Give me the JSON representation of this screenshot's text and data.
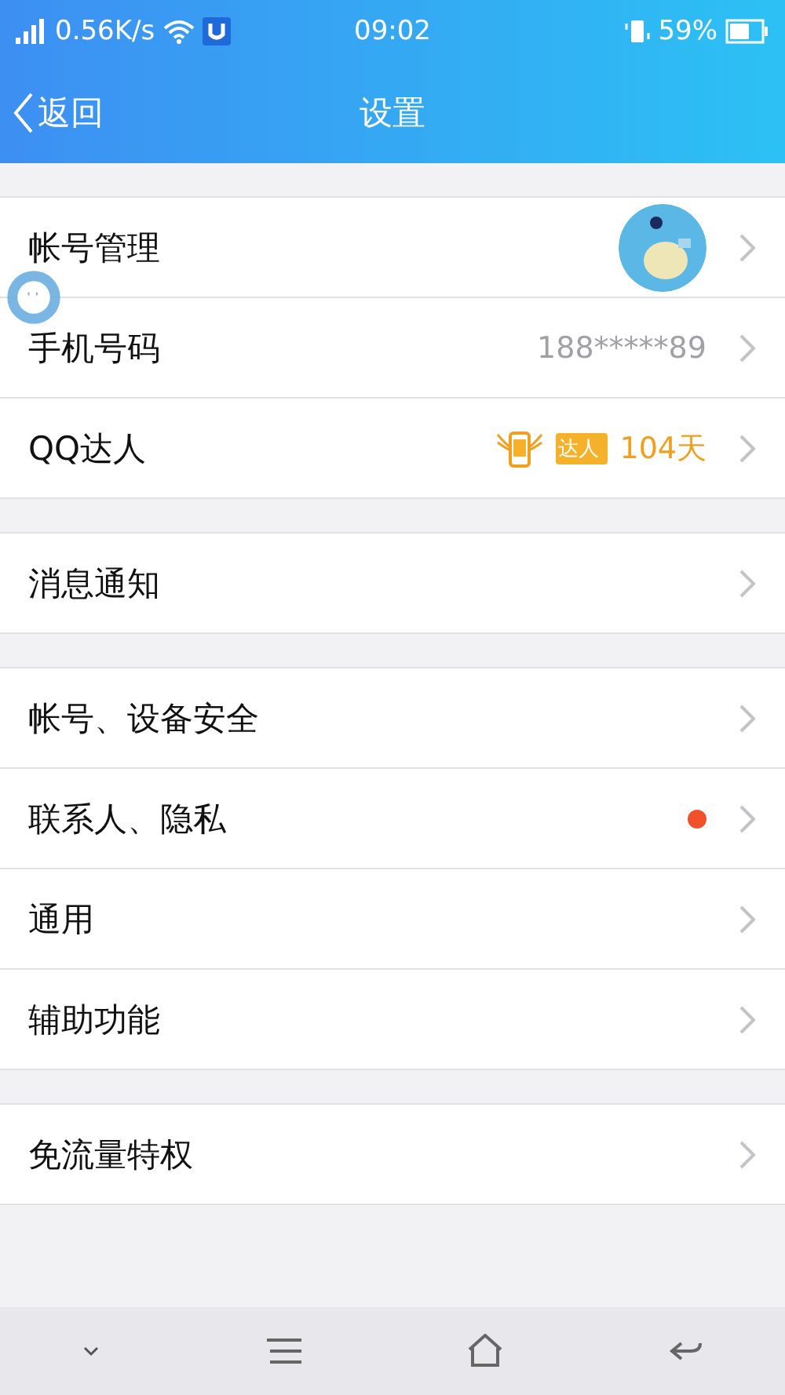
{
  "status_bar": {
    "speed": "0.56K/s",
    "time": "09:02",
    "battery": "59%"
  },
  "nav": {
    "back": "返回",
    "title": "设置"
  },
  "groups": [
    {
      "rows": [
        {
          "label": "帐号管理",
          "kind": "avatar"
        },
        {
          "label": "手机号码",
          "kind": "value",
          "value": "188*****89"
        },
        {
          "label": "QQ达人",
          "kind": "badge",
          "badge": "达人",
          "value": "104天"
        }
      ]
    },
    {
      "rows": [
        {
          "label": "消息通知",
          "kind": "plain"
        }
      ]
    },
    {
      "rows": [
        {
          "label": "帐号、设备安全",
          "kind": "plain"
        },
        {
          "label": "联系人、隐私",
          "kind": "dot",
          "color": "#f0502a"
        },
        {
          "label": "通用",
          "kind": "plain"
        },
        {
          "label": "辅助功能",
          "kind": "plain"
        }
      ]
    },
    {
      "rows": [
        {
          "label": "免流量特权",
          "kind": "plain"
        }
      ]
    }
  ]
}
